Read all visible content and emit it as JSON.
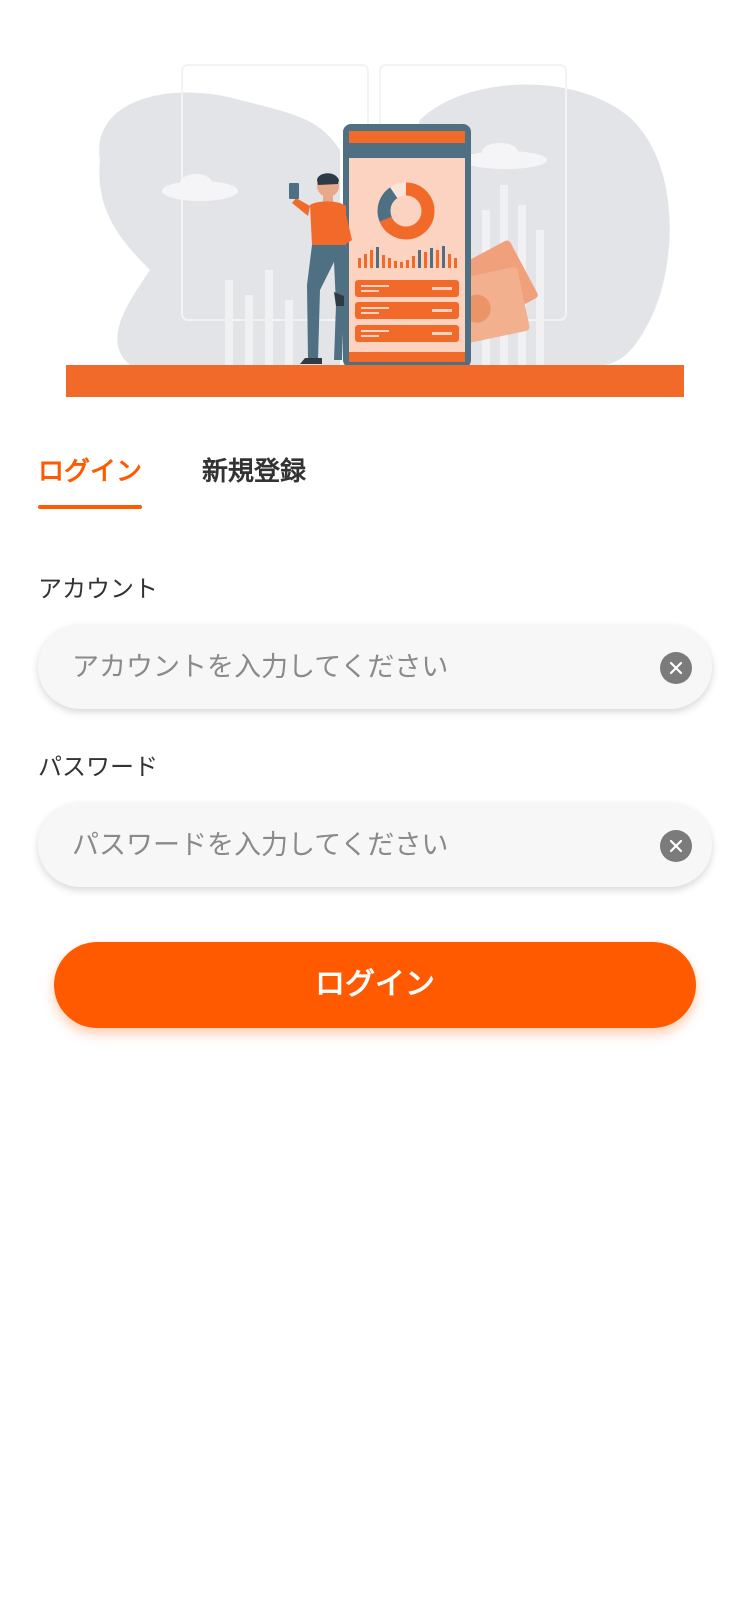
{
  "tabs": {
    "login": "ログイン",
    "register": "新規登録",
    "active": "login"
  },
  "account": {
    "label": "アカウント",
    "placeholder": "アカウントを入力してください",
    "value": ""
  },
  "password": {
    "label": "パスワード",
    "placeholder": "パスワードを入力してください",
    "value": ""
  },
  "login_button": {
    "label": "ログイン"
  },
  "icons": {
    "clear": "clear-icon",
    "illustration": "finance-app-illustration"
  },
  "colors": {
    "accent": "#ff5a00",
    "illustration_orange": "#f26a2a",
    "text_dark": "#333333",
    "input_bg": "#f7f7f7",
    "clear_icon_bg": "#7b7b7b"
  }
}
